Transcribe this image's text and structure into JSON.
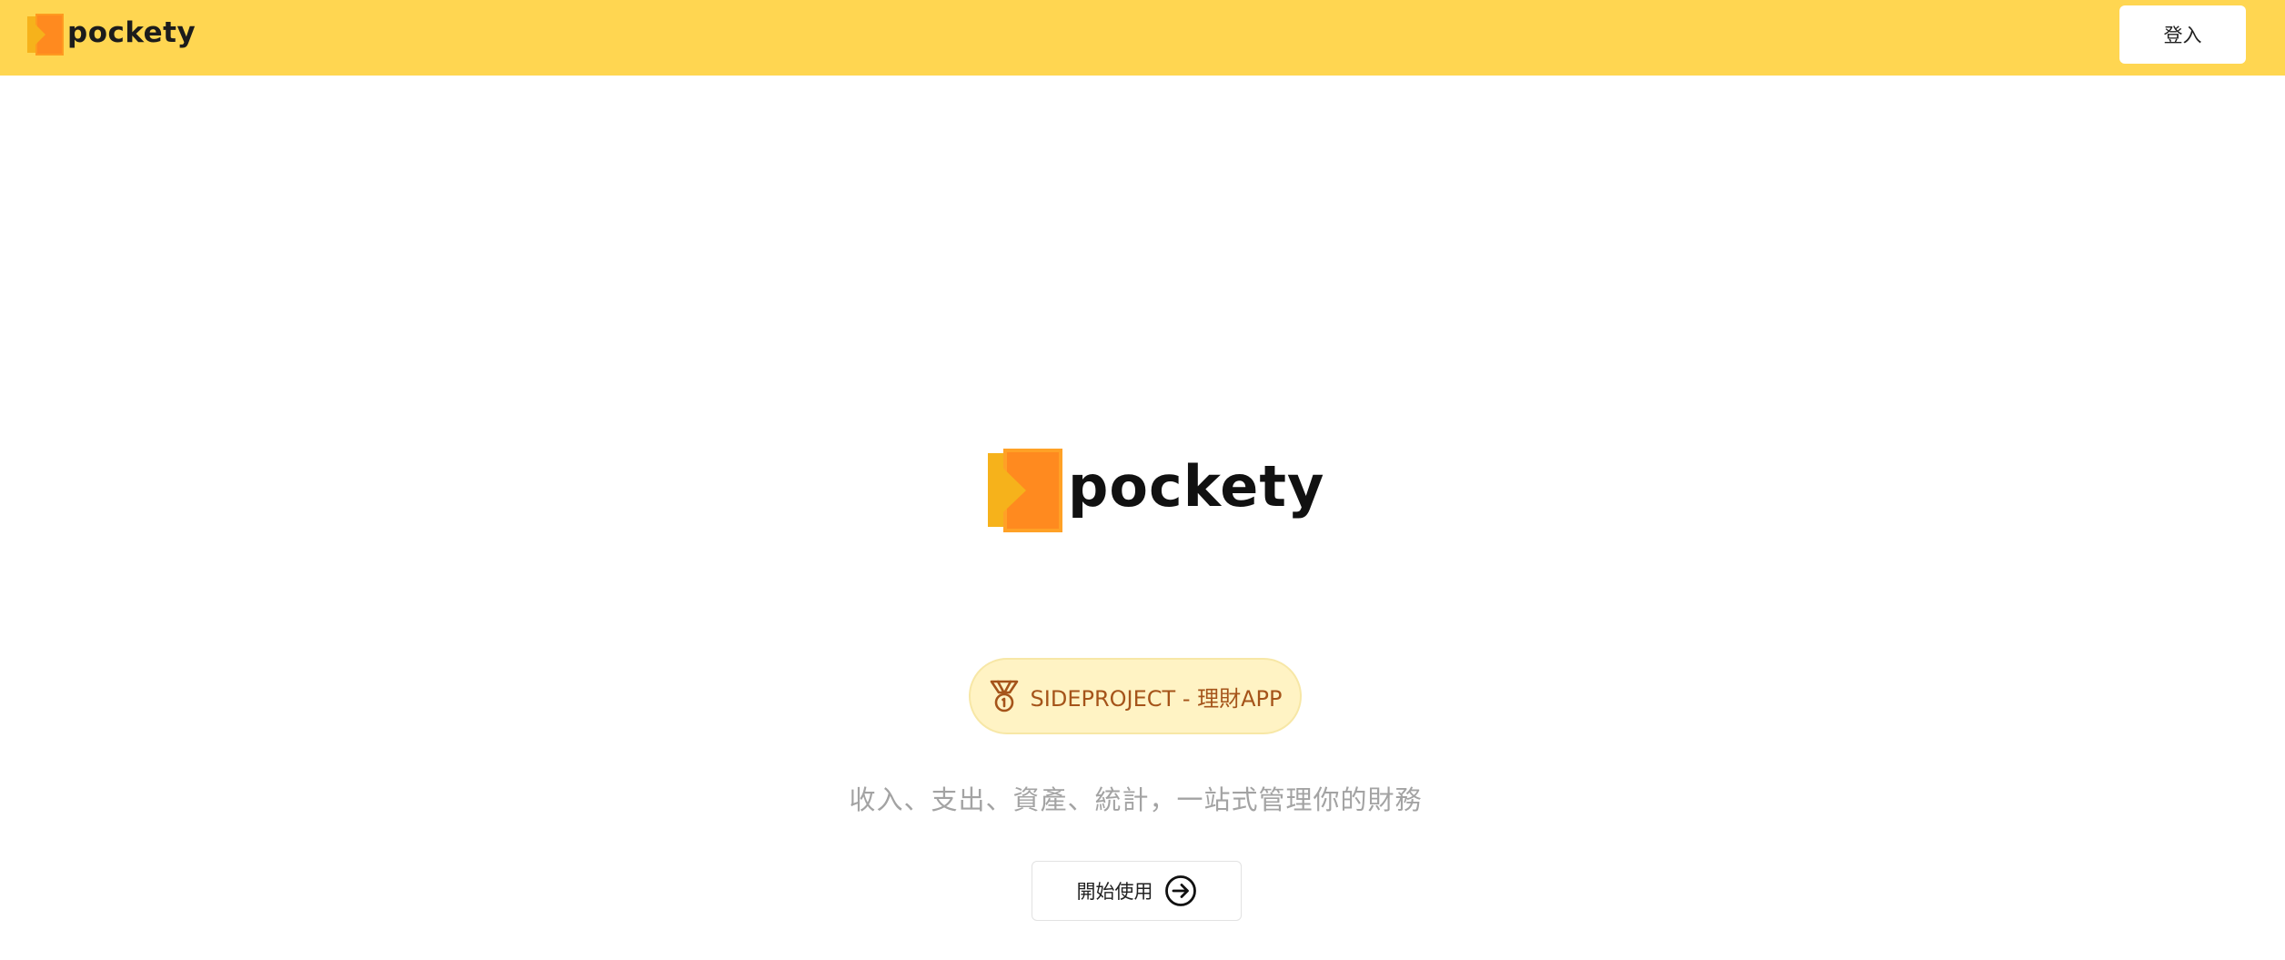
{
  "header": {
    "brand_name": "pockety",
    "logo_icon": "pockety-logo-icon",
    "login_label": "登入",
    "background_color": "#ffd651"
  },
  "hero": {
    "brand_name": "pockety",
    "logo_icon": "pockety-logo-icon",
    "badge": {
      "icon": "medal-icon",
      "label": "SIDEPROJECT - 理財APP",
      "text_color": "#a5541a",
      "background_color": "#fff3c4"
    },
    "tagline": "收入、支出、資產、統計，一站式管理你的財務",
    "cta": {
      "label": "開始使用",
      "icon": "arrow-right-circle-icon"
    }
  },
  "colors": {
    "logo_back": "#f6b21b",
    "logo_front": "#ff8a1f",
    "accent_yellow": "#ffd651"
  }
}
